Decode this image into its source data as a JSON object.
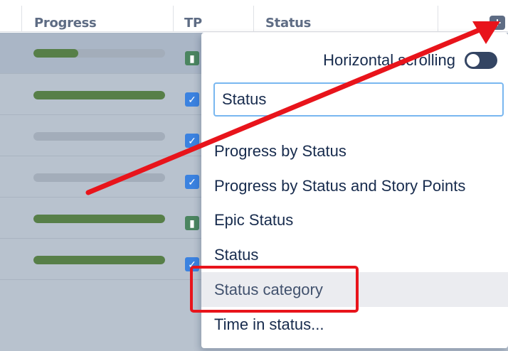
{
  "table": {
    "columns": [
      "Progress",
      "TP",
      "Status"
    ],
    "add_column_icon": "plus-square-icon",
    "rows": [
      {
        "progress": 0.34,
        "type": "story",
        "selected": true
      },
      {
        "progress": 1.0,
        "type": "task",
        "selected": false
      },
      {
        "progress": 0.0,
        "type": "task",
        "selected": false
      },
      {
        "progress": 0.0,
        "type": "task",
        "selected": false
      },
      {
        "progress": 1.0,
        "type": "story",
        "selected": false
      },
      {
        "progress": 1.0,
        "type": "task",
        "selected": false
      }
    ]
  },
  "menu": {
    "toggle_label": "Horizontal scrolling",
    "toggle_on": false,
    "search_value": "Status",
    "items": [
      "Progress by Status",
      "Progress by Status and Story Points",
      "Epic Status",
      "Status",
      "Status category",
      "Time in status..."
    ],
    "hovered_item": "Status category"
  },
  "colors": {
    "annotation_red": "#e8141b",
    "progress_green": "#577f48",
    "story_green": "#4b8560",
    "task_blue": "#3b82e0"
  }
}
